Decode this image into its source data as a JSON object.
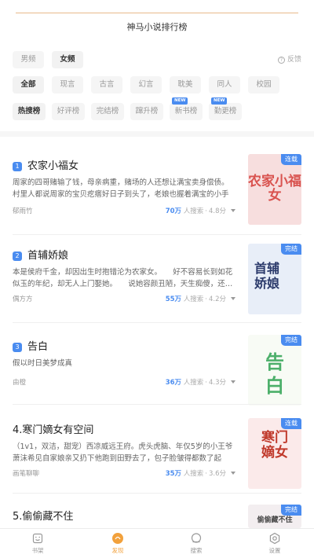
{
  "app": {
    "title": "神马小说排行榜"
  },
  "segments": [
    {
      "label": "男频",
      "active": false
    },
    {
      "label": "女频",
      "active": true
    }
  ],
  "feedback": {
    "label": "反馈"
  },
  "genres": [
    {
      "label": "全部",
      "active": true
    },
    {
      "label": "现言",
      "active": false
    },
    {
      "label": "古言",
      "active": false
    },
    {
      "label": "幻言",
      "active": false
    },
    {
      "label": "耽美",
      "active": false
    },
    {
      "label": "同人",
      "active": false
    },
    {
      "label": "校园",
      "active": false
    }
  ],
  "ranks": [
    {
      "label": "热搜榜",
      "active": true,
      "badge": ""
    },
    {
      "label": "好评榜",
      "active": false,
      "badge": ""
    },
    {
      "label": "完结榜",
      "active": false,
      "badge": ""
    },
    {
      "label": "蹿升榜",
      "active": false,
      "badge": ""
    },
    {
      "label": "新书榜",
      "active": false,
      "badge": "NEW"
    },
    {
      "label": "勤更榜",
      "active": false,
      "badge": "NEW"
    }
  ],
  "books": [
    {
      "rank": "1",
      "title": "农家小福女",
      "desc": "周家的四哥赌输了钱，母亲病重，赌场的人还想让满宝卖身偿债。村里人都说周家的宝贝疙瘩好日子到头了，老娘也握着满宝的小手哭…",
      "author": "郁雨竹",
      "count": "70万",
      "count_suffix": "人搜索",
      "rating": "4.8分",
      "status": "连载",
      "cover_text": "农家小福女",
      "cover_bg": "#f7dede",
      "cover_fg": "#d9534f"
    },
    {
      "rank": "2",
      "title": "首辅娇娘",
      "desc": "本是侯府千金，却因出生时抱错沦为农家女。　　好不容易长到如花似玉的年纪，却无人上门娶她。　　说她容颜丑陋，天生痴傻，还…",
      "author": "偶方方",
      "count": "55万",
      "count_suffix": "人搜索",
      "rating": "4.2分",
      "status": "完结",
      "cover_text": "首辅娇娘",
      "cover_bg": "#e8eef8",
      "cover_fg": "#2b3a6b"
    },
    {
      "rank": "3",
      "title": "告白",
      "desc": "假以时日美梦成真",
      "author": "由橙",
      "count": "36万",
      "count_suffix": "人搜索",
      "rating": "4.3分",
      "status": "完结",
      "cover_text": "告白",
      "cover_bg": "#f8fbf5",
      "cover_fg": "#4caf6a"
    },
    {
      "rank": "4.",
      "title": "寒门嫡女有空间",
      "desc": "（1v1，双洁，甜宠）西凉威远王府。虎头虎脑、年仅5岁的小王爷萧沫希见自家娘亲又扔下他跑到田野去了，包子脸皱得都数了起来。…",
      "author": "画笔聊聊",
      "count": "35万",
      "count_suffix": "人搜索",
      "rating": "3.6分",
      "status": "连载",
      "cover_text": "寒门嫡女",
      "cover_bg": "#fbeaea",
      "cover_fg": "#c0392b"
    },
    {
      "rank": "5.",
      "title": "偷偷藏不住",
      "status": "完结",
      "cover_text": "偷偷藏不住",
      "cover_bg": "#f3eef0",
      "cover_fg": "#444444"
    }
  ],
  "tabbar": [
    {
      "label": "书架",
      "icon": "bookshelf-icon",
      "active": false
    },
    {
      "label": "发现",
      "icon": "discover-icon",
      "active": true
    },
    {
      "label": "搜索",
      "icon": "search-icon",
      "active": false
    },
    {
      "label": "设置",
      "icon": "settings-icon",
      "active": false
    }
  ],
  "colors": {
    "accent": "#4a8cf0",
    "tab_active": "#f2a13c"
  }
}
